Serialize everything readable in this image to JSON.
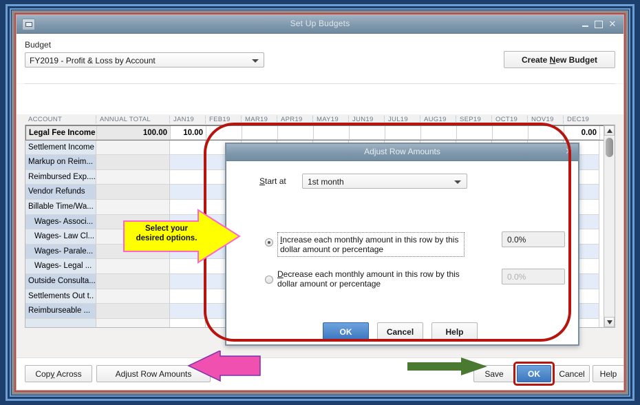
{
  "window": {
    "title": "Set Up Budgets",
    "sysmenu_icon": "window-menu-icon",
    "minimize_icon": "minimize-icon",
    "maximize_icon": "maximize-icon",
    "close_icon": "close-icon"
  },
  "budget": {
    "label": "Budget",
    "selected": "FY2019 - Profit & Loss by Account",
    "caret_icon": "chevron-down-icon",
    "create_button_pre": "Create ",
    "create_button_accel": "N",
    "create_button_post": "ew Budget"
  },
  "grid": {
    "columns": [
      "ACCOUNT",
      "ANNUAL TOTAL",
      "JAN19",
      "FEB19",
      "MAR19",
      "APR19",
      "MAY19",
      "JUN19",
      "JUL19",
      "AUG19",
      "SEP19",
      "OCT19",
      "NOV19",
      "DEC19"
    ],
    "rows": [
      {
        "account": "Legal Fee Income",
        "annual_total": "100.00",
        "jan19": "10.00",
        "dec19": "0.00",
        "indent": false,
        "selected": true
      },
      {
        "account": "Settlement Income",
        "annual_total": "",
        "jan19": "",
        "dec19": "",
        "indent": false,
        "selected": false
      },
      {
        "account": "Markup on Reim...",
        "annual_total": "",
        "jan19": "",
        "dec19": "",
        "indent": false,
        "selected": false
      },
      {
        "account": "Reimbursed Exp....",
        "annual_total": "",
        "jan19": "",
        "dec19": "",
        "indent": false,
        "selected": false
      },
      {
        "account": "Vendor Refunds",
        "annual_total": "",
        "jan19": "",
        "dec19": "",
        "indent": false,
        "selected": false
      },
      {
        "account": "Billable Time/Wa...",
        "annual_total": "",
        "jan19": "",
        "dec19": "",
        "indent": false,
        "selected": false
      },
      {
        "account": "Wages- Associ...",
        "annual_total": "",
        "jan19": "",
        "dec19": "",
        "indent": true,
        "selected": false
      },
      {
        "account": "Wages- Law Cl...",
        "annual_total": "",
        "jan19": "",
        "dec19": "",
        "indent": true,
        "selected": false
      },
      {
        "account": "Wages- Parale...",
        "annual_total": "",
        "jan19": "",
        "dec19": "",
        "indent": true,
        "selected": false
      },
      {
        "account": "Wages- Legal ...",
        "annual_total": "",
        "jan19": "",
        "dec19": "",
        "indent": true,
        "selected": false
      },
      {
        "account": "Outside Consulta...",
        "annual_total": "",
        "jan19": "",
        "dec19": "",
        "indent": false,
        "selected": false
      },
      {
        "account": "Settlements Out t..",
        "annual_total": "",
        "jan19": "",
        "dec19": "",
        "indent": false,
        "selected": false
      },
      {
        "account": "Reimburseable ...",
        "annual_total": "",
        "jan19": "",
        "dec19": "",
        "indent": false,
        "selected": false
      },
      {
        "account": "",
        "annual_total": "",
        "jan19": "",
        "dec19": "",
        "indent": false,
        "selected": false
      }
    ],
    "scrollbar": {
      "up_icon": "scroll-up-arrow-icon",
      "down_icon": "scroll-down-arrow-icon"
    }
  },
  "footer": {
    "copy_across_pre": "Cop",
    "copy_across_accel": "y",
    "copy_across_post": " Across",
    "adjust_row_amounts": "Adjust Row Amounts",
    "save": "Save",
    "ok": "OK",
    "cancel": "Cancel",
    "help": "Help"
  },
  "dialog": {
    "title": "Adjust Row Amounts",
    "close_icon": "close-icon",
    "start_at": {
      "label_accel": "S",
      "label_rest": "tart at",
      "value": "1st month",
      "caret_icon": "chevron-down-icon"
    },
    "increase": {
      "accel": "I",
      "rest": "ncrease each monthly amount in this row by this dollar amount or percentage",
      "amount": "0.0%",
      "selected": true
    },
    "decrease": {
      "accel": "D",
      "rest": "ecrease each monthly amount in this row by this dollar amount or percentage",
      "amount": "0.0%",
      "selected": false
    },
    "buttons": {
      "ok": "OK",
      "cancel": "Cancel",
      "help": "Help"
    }
  },
  "annotations": {
    "callout_line1": "Select your",
    "callout_line2": "desired options.",
    "callout_fill": "#FFFF00",
    "callout_stroke": "#FF66CC",
    "ellipse_color": "#B5140F",
    "pink_arrow_color": "#F050B0",
    "green_arrow_color": "#4A7A32",
    "ok_highlight_color": "#B5140F"
  }
}
